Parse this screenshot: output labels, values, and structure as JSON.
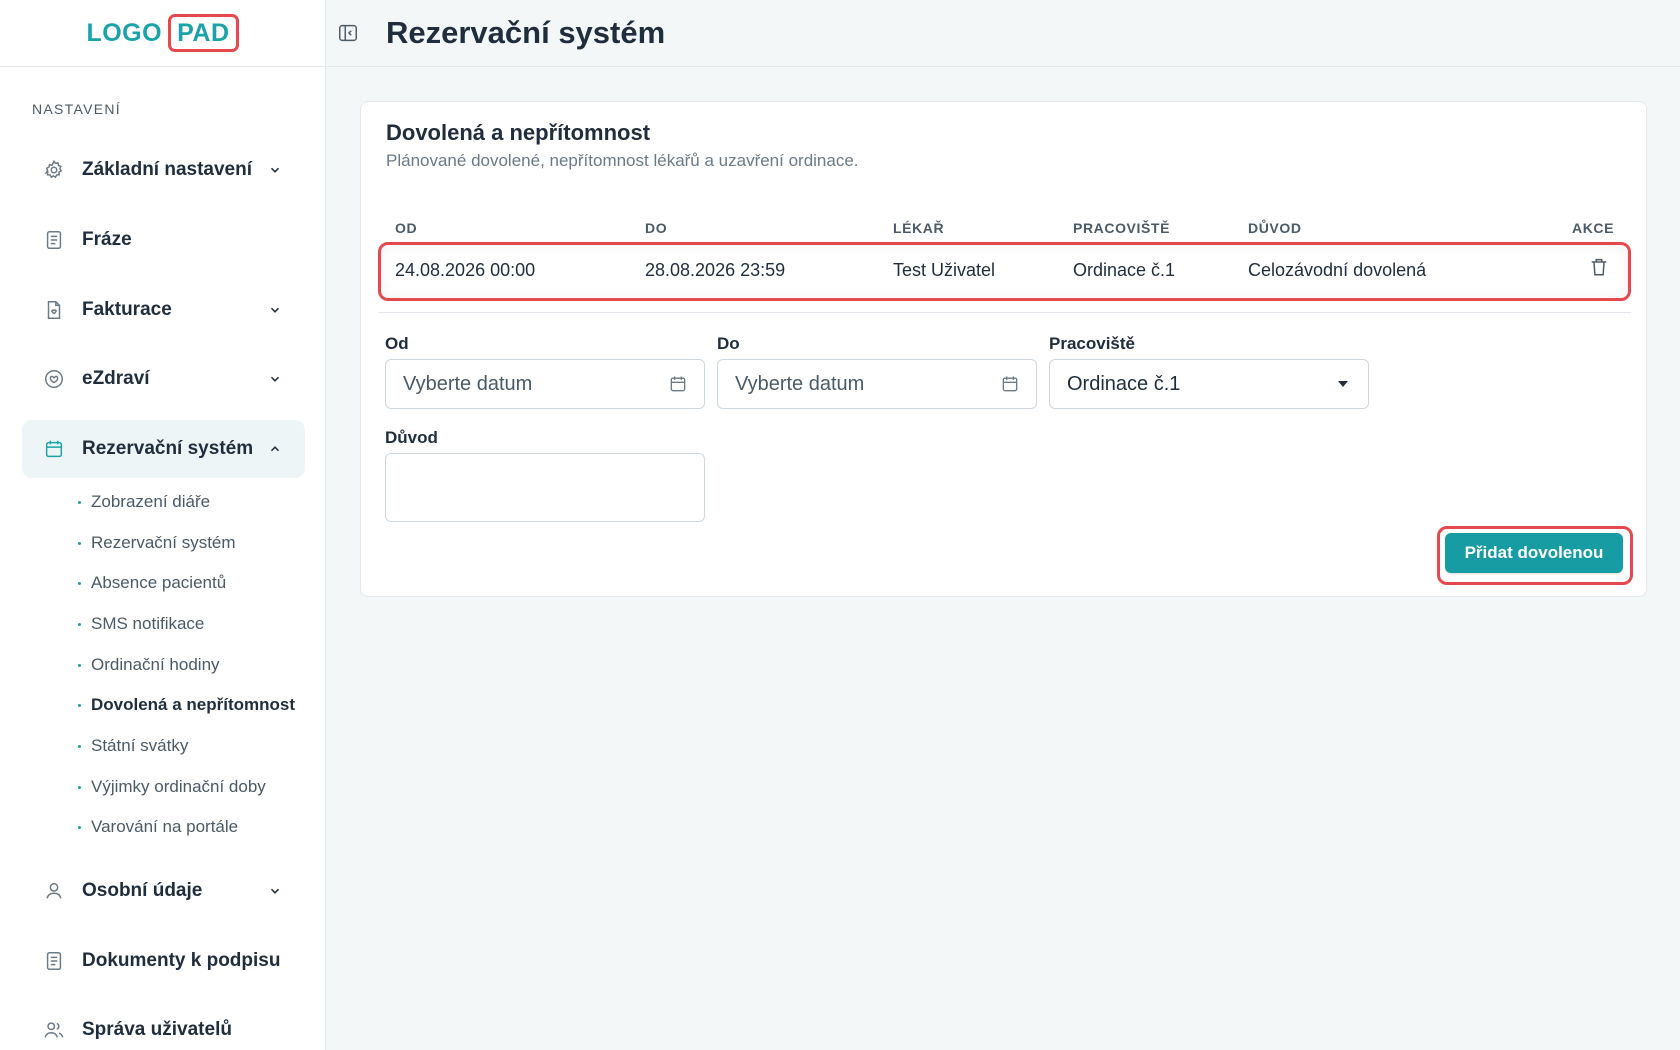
{
  "logo": {
    "part1": "LOGO",
    "part2": "PAD"
  },
  "header": {
    "title": "Rezervační systém"
  },
  "sidebar": {
    "section_label": "NASTAVENÍ",
    "items": [
      {
        "label": "Základní nastavení",
        "icon": "gear-icon"
      },
      {
        "label": "Fráze",
        "icon": "document-icon"
      },
      {
        "label": "Fakturace",
        "icon": "invoice-icon"
      },
      {
        "label": "eZdraví",
        "icon": "heart-icon"
      },
      {
        "label": "Rezervační systém",
        "icon": "calendar-icon"
      },
      {
        "label": "Osobní údaje",
        "icon": "user-icon"
      },
      {
        "label": "Dokumenty k podpisu",
        "icon": "document-icon"
      },
      {
        "label": "Správa uživatelů",
        "icon": "users-icon"
      }
    ],
    "subitems": [
      "Zobrazení diáře",
      "Rezervační systém",
      "Absence pacientů",
      "SMS notifikace",
      "Ordinační hodiny",
      "Dovolená a nepřítomnost",
      "Státní svátky",
      "Výjimky ordinační doby",
      "Varování na portále"
    ]
  },
  "card": {
    "title": "Dovolená a nepřítomnost",
    "subtitle": "Plánované dovolené, nepřítomnost lékařů a uzavření ordinace.",
    "table": {
      "headers": [
        "OD",
        "DO",
        "LÉKAŘ",
        "PRACOVIŠTĚ",
        "DŮVOD",
        "AKCE"
      ],
      "rows": [
        {
          "od": "24.08.2026 00:00",
          "do": "28.08.2026 23:59",
          "lekar": "Test Uživatel",
          "pracoviste": "Ordinace č.1",
          "duvod": "Celozávodní dovolená"
        }
      ]
    },
    "form": {
      "od_label": "Od",
      "od_placeholder": "Vyberte datum",
      "do_label": "Do",
      "do_placeholder": "Vyberte datum",
      "pracoviste_label": "Pracoviště",
      "pracoviste_value": "Ordinace č.1",
      "duvod_label": "Důvod",
      "duvod_value": "",
      "submit_label": "Přidat dovolenou"
    }
  },
  "colors": {
    "accent": "#169ca2",
    "highlight": "#e5484d",
    "text": "#1f2d3d"
  }
}
